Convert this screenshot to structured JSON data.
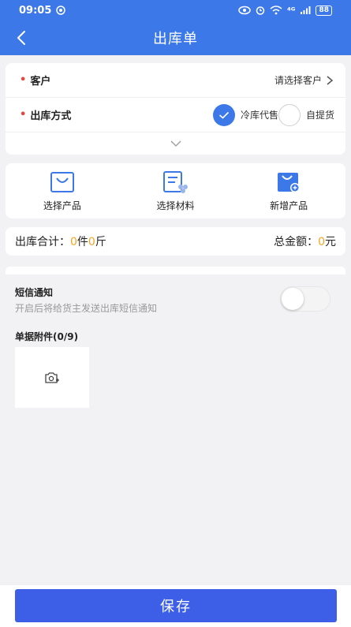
{
  "status": {
    "time": "09:05",
    "network": "⁴ᴳ",
    "battery": "88"
  },
  "nav": {
    "title": "出库单"
  },
  "form": {
    "customer_label": "客户",
    "customer_placeholder": "请选择客户",
    "method_label": "出库方式",
    "options": [
      "冷库代售",
      "自提货"
    ],
    "selected_option": "冷库代售"
  },
  "actions": [
    {
      "label": "选择产品",
      "icon": "shopping-bag-icon"
    },
    {
      "label": "选择材料",
      "icon": "material-list-icon"
    },
    {
      "label": "新增产品",
      "icon": "add-product-icon"
    }
  ],
  "totals": {
    "qty_label": "出库合计：",
    "qty_pieces": "0",
    "unit_pieces": "件",
    "qty_weight": "0",
    "unit_weight": "斤",
    "amount_label": "总金额：",
    "amount": "0",
    "currency": "元"
  },
  "sms": {
    "title": "短信通知",
    "desc": "开启后将给货主发送出库短信通知",
    "enabled": false
  },
  "attachments": {
    "title": "单据附件(0/9)"
  },
  "save_label": "保存",
  "colors": {
    "primary": "#3d78e8",
    "save": "#3d5fe8",
    "accent": "#f5a623",
    "required": "#e8453c"
  }
}
